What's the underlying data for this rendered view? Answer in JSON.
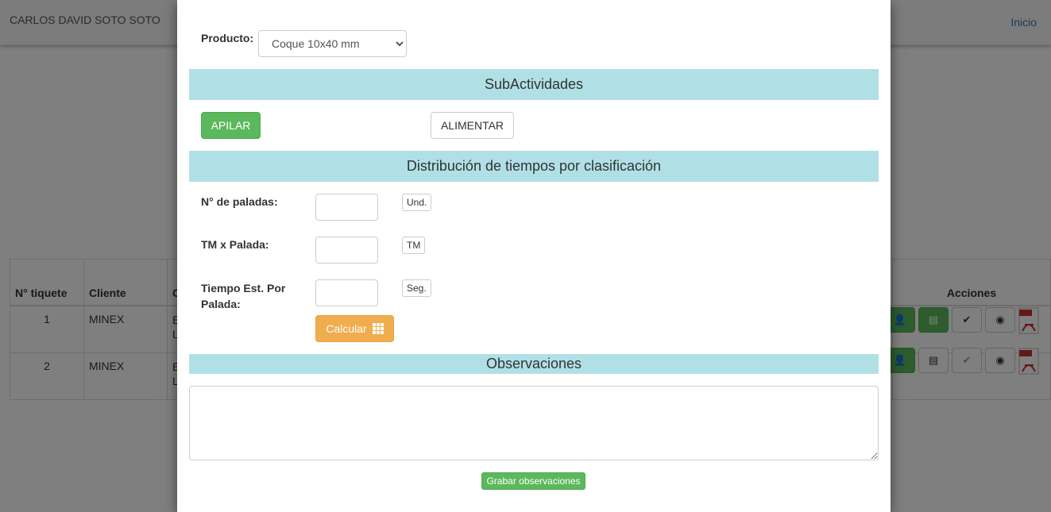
{
  "navbar": {
    "user_name": "CARLOS DAVID SOTO SOTO",
    "home_link": "Inicio"
  },
  "table": {
    "headers": {
      "ticket": "N° tiquete",
      "client": "Cliente",
      "col3": "C",
      "actions": "Acciones"
    },
    "rows": [
      {
        "ticket": "1",
        "client": "MINEX",
        "col3": "E\nL"
      },
      {
        "ticket": "2",
        "client": "MINEX",
        "col3": "E\nL"
      }
    ]
  },
  "modal": {
    "product_label": "Producto:",
    "product_value": "Coque 10x40 mm",
    "subactivities_title": "SubActividades",
    "apilar_button": "APILAR",
    "alimentar_button": "ALIMENTAR",
    "distribution_title": "Distribución de tiempos por clasificación",
    "paladas_label": "N° de paladas:",
    "paladas_unit": "Und.",
    "tm_label": "TM x Palada:",
    "tm_unit": "TM",
    "tiempo_label": "Tiempo Est. Por Palada:",
    "tiempo_unit": "Seg.",
    "calcular_button": "Calcular",
    "observations_title": "Observaciones",
    "save_observations_button": "Grabar observaciones"
  },
  "icons": [
    "user-icon",
    "list-icon",
    "check-icon",
    "eye-icon",
    "pdf-icon",
    "grid-icon",
    "caret-down-icon"
  ]
}
